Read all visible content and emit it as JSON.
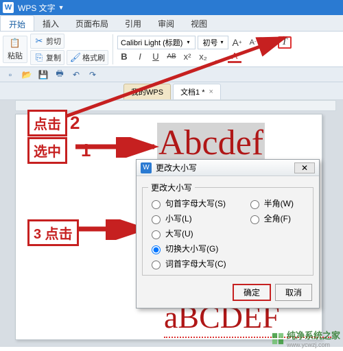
{
  "titlebar": {
    "logo": "W",
    "app_name": "WPS 文字"
  },
  "menu": {
    "tabs": [
      "开始",
      "插入",
      "页面布局",
      "引用",
      "审阅",
      "视图"
    ],
    "active": 0
  },
  "ribbon": {
    "paste": "粘贴",
    "cut": "剪切",
    "copy": "复制",
    "format_painter": "格式刷",
    "font_name": "Calibri Light (标题)",
    "font_size": "初号",
    "grow": "A",
    "shrink": "A",
    "clear": "A",
    "case": "T",
    "bold": "B",
    "italic": "I",
    "underline": "U",
    "ab": "AB"
  },
  "doc_tabs": {
    "t1": "我的WPS",
    "t2": "文档1 *"
  },
  "annotations": {
    "step1_label": "选中",
    "step1_num": "1",
    "step2_label": "点击",
    "step2_num": "2",
    "step3_label": "3 点击"
  },
  "sample": {
    "before": "Abcdef",
    "after": "aBCDEF"
  },
  "dialog": {
    "title": "更改大小写",
    "group": "更改大小写",
    "opt_sentence": "句首字母大写(S)",
    "opt_lower": "小写(L)",
    "opt_upper": "大写(U)",
    "opt_toggle": "切换大小写(G)",
    "opt_capitalize": "词首字母大写(C)",
    "opt_half": "半角(W)",
    "opt_full": "全角(F)",
    "ok": "确定",
    "cancel": "取消"
  },
  "watermark": {
    "text": "纯净系统之家",
    "url": "www.ycwzj.com"
  }
}
